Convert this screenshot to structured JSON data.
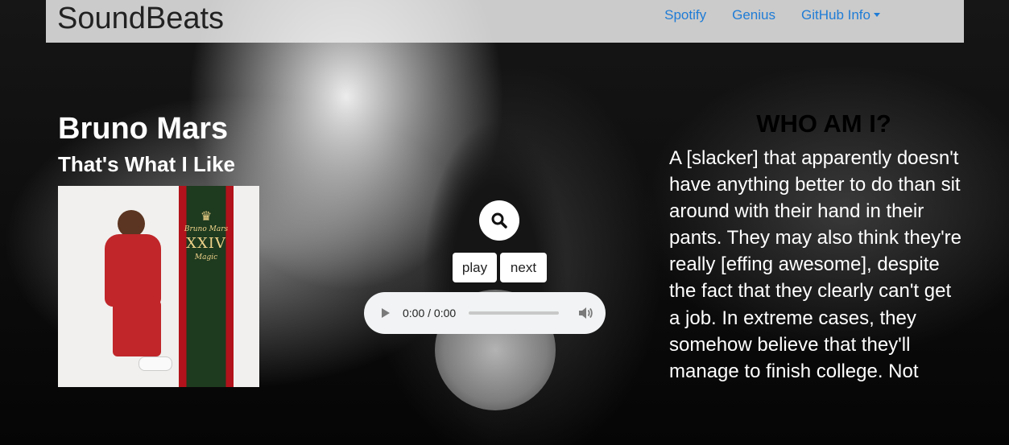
{
  "navbar": {
    "brand": "SoundBeats",
    "links": [
      "Spotify",
      "Genius"
    ],
    "dropdown_label": "GitHub Info"
  },
  "track": {
    "artist": "Bruno Mars",
    "song": "That's What I Like"
  },
  "album": {
    "band_small": "Bruno Mars",
    "band_numeral": "XXIV",
    "band_word": "Magic"
  },
  "controls": {
    "play_label": "play",
    "next_label": "next",
    "search_icon": "search-icon"
  },
  "audio": {
    "time": "0:00 / 0:00",
    "progress": 0
  },
  "sidebar": {
    "heading": "WHO AM I?",
    "text": "A [slacker] that apparently doesn't have anything better to do than sit around with their hand in their pants. They may also think they're really [effing awesome], despite the fact that they clearly can't get a job. In extreme cases, they somehow believe that they'll manage to finish college. Not"
  },
  "colors": {
    "link": "#1f7cd6",
    "navbar_bg": "#ebebeb",
    "album_red": "#b2121b",
    "album_green": "#1e3a1f"
  }
}
